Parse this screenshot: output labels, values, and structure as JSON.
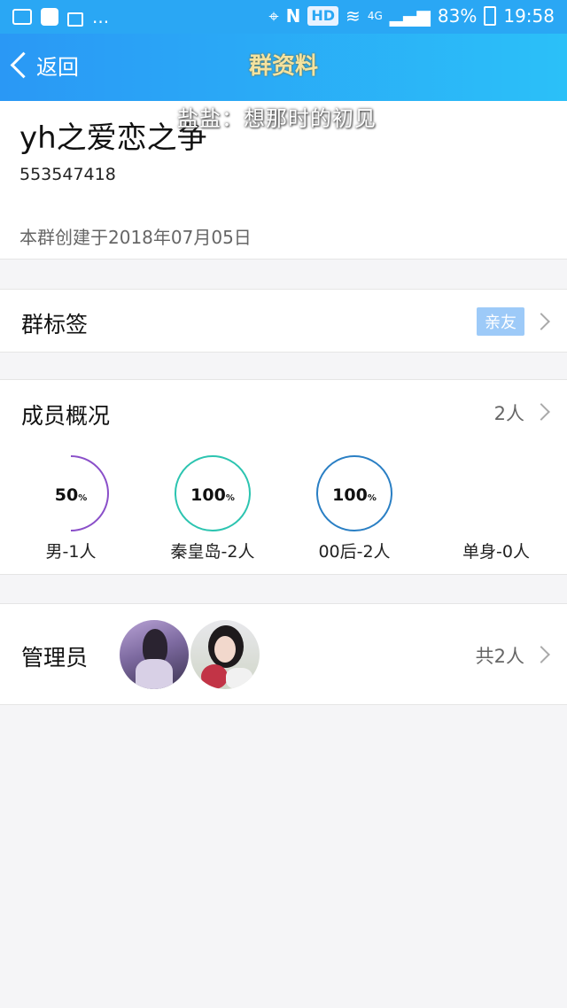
{
  "status_bar": {
    "dots": "...",
    "nfc": "N",
    "hd": "HD",
    "network": "4G",
    "battery": "83%",
    "time": "19:58"
  },
  "nav": {
    "back_label": "返回",
    "title": "群资料"
  },
  "overlay_text": "盐盐：想那时的初见",
  "group": {
    "name": "yh之爱恋之争",
    "id": "553547418",
    "created": "本群创建于2018年07月05日"
  },
  "tag_row": {
    "label": "群标签",
    "tag": "亲友"
  },
  "members_row": {
    "label": "成员概况",
    "count": "2人"
  },
  "stats": [
    {
      "percent": "50",
      "unit": "%",
      "label": "男-1人",
      "color": "#8a4fc9",
      "fraction": 0.5
    },
    {
      "percent": "100",
      "unit": "%",
      "label": "秦皇岛-2人",
      "color": "#2cc4b0",
      "fraction": 1.0
    },
    {
      "percent": "100",
      "unit": "%",
      "label": "00后-2人",
      "color": "#2a7fc4",
      "fraction": 1.0
    },
    {
      "percent": "",
      "unit": "",
      "label": "单身-0人",
      "color": "#cccccc",
      "fraction": 0
    }
  ],
  "admins_row": {
    "label": "管理员",
    "count": "共2人"
  }
}
